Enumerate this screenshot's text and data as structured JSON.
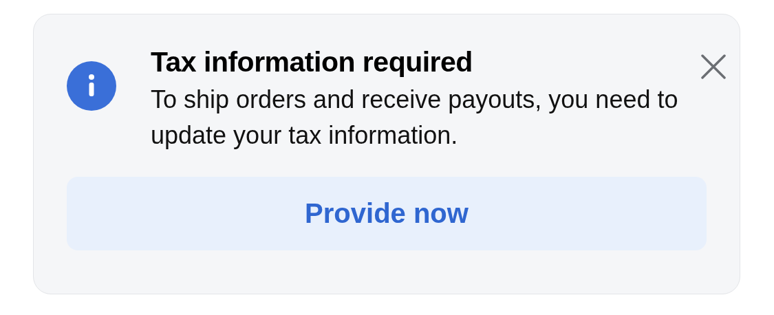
{
  "banner": {
    "title": "Tax information required",
    "message": "To ship orders and receive payouts, you need to update your tax information.",
    "button": "Provide now"
  }
}
